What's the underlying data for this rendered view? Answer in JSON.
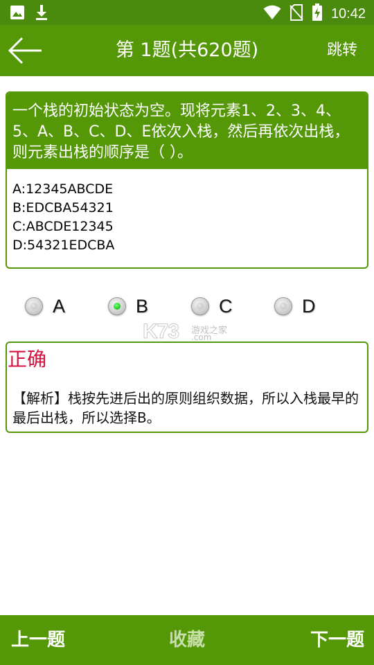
{
  "status_bar": {
    "time": "10:42",
    "icons": [
      "image-icon",
      "download-icon",
      "wifi-icon",
      "no-sim-icon",
      "battery-charging-icon"
    ]
  },
  "app_bar": {
    "title": "第 1题(共620题)",
    "jump_label": "跳转",
    "back_icon": "arrow-left-icon"
  },
  "question": {
    "text": "一个栈的初始状态为空。现将元素1、2、3、4、5、A、B、C、D、E依次入栈，然后再依次出栈，则元素出栈的顺序是（ ）。",
    "options": [
      "A:12345ABCDE",
      "B:EDCBA54321",
      "C:ABCDE12345",
      "D:54321EDCBA"
    ]
  },
  "choices": {
    "labels": [
      "A",
      "B",
      "C",
      "D"
    ],
    "selected": "B"
  },
  "watermark": {
    "main": "K73",
    "sub": "游戏之家",
    "domain": ".com"
  },
  "answer": {
    "result": "正确",
    "explanation": "【解析】栈按先进后出的原则组织数据，所以入栈最早的最后出栈，所以选择B。"
  },
  "bottom_bar": {
    "prev_label": "上一题",
    "favorite_label": "收藏",
    "next_label": "下一题"
  },
  "colors": {
    "primary_green": "#559807",
    "status_green": "#4a8a0c",
    "correct_red": "#d6103e",
    "radio_selected": "#18c418"
  }
}
